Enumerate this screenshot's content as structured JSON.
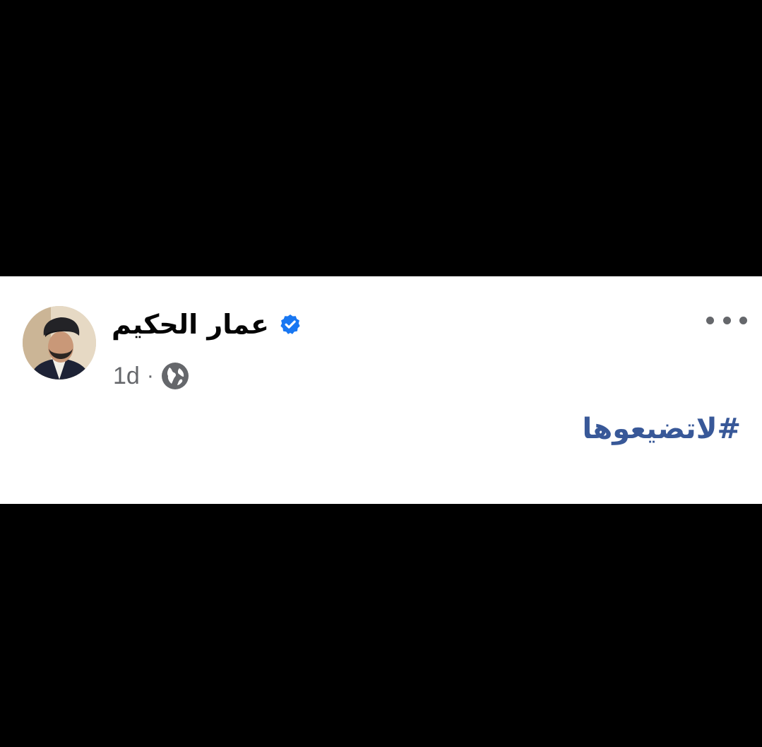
{
  "post": {
    "author_name": "عمار الحكيم",
    "verified_icon": "verified-badge-icon",
    "time": "1d",
    "separator": "·",
    "audience_icon": "globe-icon",
    "more_icon": "more-horizontal-icon",
    "hashtag": "#لاتضيعوها"
  },
  "colors": {
    "background": "#000000",
    "card": "#ffffff",
    "author_text": "#050505",
    "meta_text": "#65676b",
    "verified_blue": "#1877f2",
    "hashtag_blue": "#385898"
  }
}
